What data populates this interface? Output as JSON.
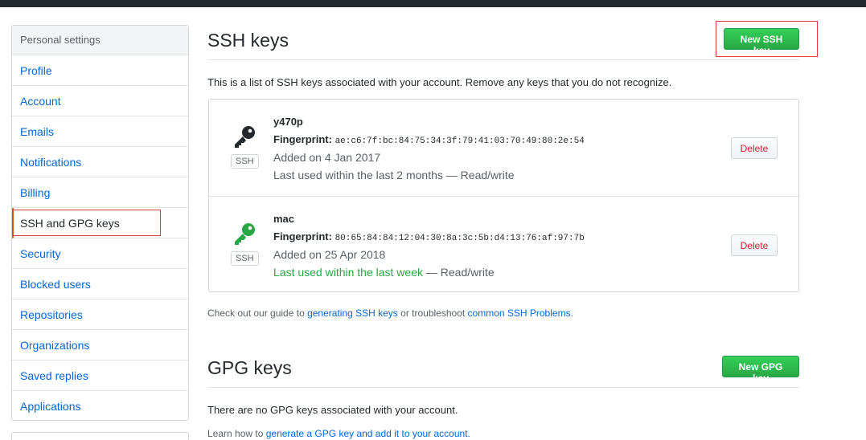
{
  "sidebar": {
    "header": "Personal settings",
    "items": [
      {
        "label": "Profile"
      },
      {
        "label": "Account"
      },
      {
        "label": "Emails"
      },
      {
        "label": "Notifications"
      },
      {
        "label": "Billing"
      },
      {
        "label": "SSH and GPG keys"
      },
      {
        "label": "Security"
      },
      {
        "label": "Blocked users"
      },
      {
        "label": "Repositories"
      },
      {
        "label": "Organizations"
      },
      {
        "label": "Saved replies"
      },
      {
        "label": "Applications"
      }
    ],
    "selected_index": 5
  },
  "ssh": {
    "title": "SSH keys",
    "new_button": "New SSH key",
    "description": "This is a list of SSH keys associated with your account. Remove any keys that you do not recognize.",
    "keys": [
      {
        "name": "y470p",
        "fingerprint_label": "Fingerprint:",
        "fingerprint": "ae:c6:7f:bc:84:75:34:3f:79:41:03:70:49:80:2e:54",
        "added": "Added on 4 Jan 2017",
        "last_used_recent": "",
        "last_used": "Last used within the last 2 months — Read/write",
        "badge": "SSH",
        "icon_color": "#24292e",
        "delete_label": "Delete"
      },
      {
        "name": "mac",
        "fingerprint_label": "Fingerprint:",
        "fingerprint": "80:65:84:84:12:04:30:8a:3c:5b:d4:13:76:af:97:7b",
        "added": "Added on 25 Apr 2018",
        "last_used_recent": "Last used within the last week",
        "last_used": " — Read/write",
        "badge": "SSH",
        "icon_color": "#28a745",
        "delete_label": "Delete"
      }
    ],
    "guide": {
      "prefix": "Check out our guide to ",
      "link1": "generating SSH keys",
      "middle": " or troubleshoot ",
      "link2": "common SSH Problems",
      "suffix": "."
    }
  },
  "gpg": {
    "title": "GPG keys",
    "new_button": "New GPG key",
    "empty": "There are no GPG keys associated with your account.",
    "learn": {
      "prefix": "Learn how to ",
      "link": "generate a GPG key and add it to your account",
      "suffix": "."
    }
  },
  "colors": {
    "accent_link": "#0366d6",
    "green": "#28a745",
    "danger": "#cb2431",
    "highlight_box": "#e4393c"
  },
  "icons": {
    "key": "key-icon"
  }
}
